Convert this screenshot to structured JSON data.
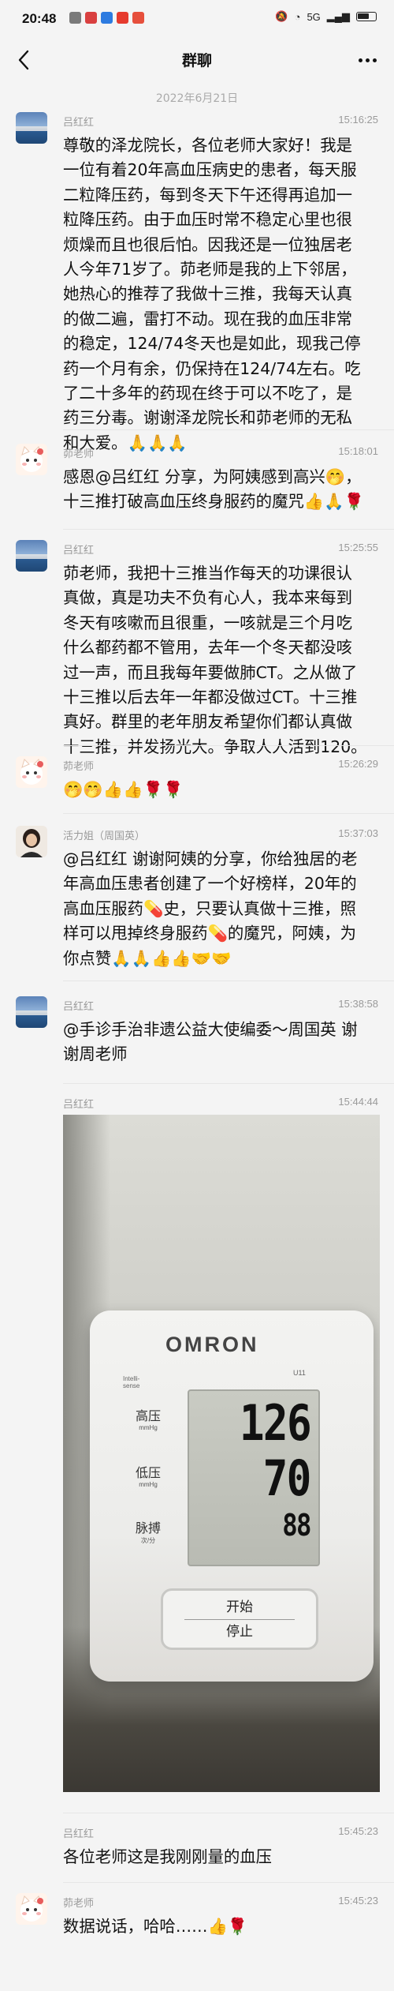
{
  "status_bar": {
    "time": "20:48",
    "signal_text": "5G",
    "app_icon_colors": [
      "#7a7a7a",
      "#d94040",
      "#2d7be0",
      "#e63b2e",
      "#e64f3c"
    ]
  },
  "header": {
    "title": "群聊",
    "back_icon": "chevron-left-icon",
    "more_icon": "more-dots-icon"
  },
  "date_separator": "2022年6月21日",
  "messages": [
    {
      "sender": "吕红红",
      "time": "15:16:25",
      "avatar": "lake-photo",
      "text": "尊敬的泽龙院长，各位老师大家好！我是\n一位有着20年高血压病史的患者，每天服\n二粒降压药，每到冬天下午还得再追加一\n粒降压药。由于血压时常不稳定心里也很\n烦燥而且也很后怕。因我还是一位独居老\n人今年71岁了。茆老师是我的上下邻居，\n她热心的推荐了我做十三推，我每天认真\n的做二遍，雷打不动。现在我的血压非常\n的稳定，124/74冬天也是如此，现我己停\n药一个月有余，仍保持在124/74左右。吃\n了二十多年的药现在终于可以不吃了，是\n药三分毒。谢谢泽龙院长和茆老师的无私\n和大爱。🙏🙏🙏"
    },
    {
      "sender": "茆老师",
      "time": "15:18:01",
      "avatar": "cat-cartoon",
      "text": "感恩@吕红红 分享，为阿姨感到高兴🤭，\n十三推打破高血压终身服药的魔咒👍🙏🌹"
    },
    {
      "sender": "吕红红",
      "time": "15:25:55",
      "avatar": "lake-photo",
      "text": "茆老师，我把十三推当作每天的功课很认\n真做，真是功夫不负有心人，我本来每到\n冬天有咳嗽而且很重，一咳就是三个月吃\n什么都药都不管用，去年一个冬天都没咳\n过一声，而且我每年要做肺CT。之从做了\n十三推以后去年一年都没做过CT。十三推\n真好。群里的老年朋友希望你们都认真做\n十三推，并发扬光大。争取人人活到120。"
    },
    {
      "sender": "茆老师",
      "time": "15:26:29",
      "avatar": "cat-cartoon",
      "text": "🤭🤭👍👍🌹🌹"
    },
    {
      "sender": "活力姐（周国英）",
      "time": "15:37:03",
      "avatar": "person-portrait",
      "text": "@吕红红 谢谢阿姨的分享，你给独居的老\n年高血压患者创建了一个好榜样，20年的\n高血压服药💊史，只要认真做十三推，照\n样可以甩掉终身服药💊的魔咒，阿姨，为\n你点赞🙏🙏👍👍🤝🤝"
    },
    {
      "sender": "吕红红",
      "time": "15:38:58",
      "avatar": "lake-photo",
      "text": "@手诊手治非遗公益大使编委～周国英 谢\n谢周老师"
    },
    {
      "sender": "吕红红",
      "time": "15:44:44",
      "avatar": "lake-photo",
      "image": {
        "brand": "OMRON",
        "model": "U11",
        "intellisense": "Intelli-\nsense",
        "systolic_label": "高压",
        "diastolic_label": "低压",
        "pulse_label": "脉搏",
        "unit_mmhg": "mmHg",
        "unit_pulse": "次/分",
        "systolic": "126",
        "diastolic": "70",
        "pulse": "88",
        "start_button": "开始",
        "stop_button": "停止"
      }
    },
    {
      "sender": "吕红红",
      "time": "15:45:23",
      "avatar": "lake-photo",
      "text": "各位老师这是我刚刚量的血压"
    },
    {
      "sender": "茆老师",
      "time": "15:45:23",
      "avatar": "cat-cartoon",
      "text": "数据说话，哈哈……👍🌹"
    }
  ]
}
